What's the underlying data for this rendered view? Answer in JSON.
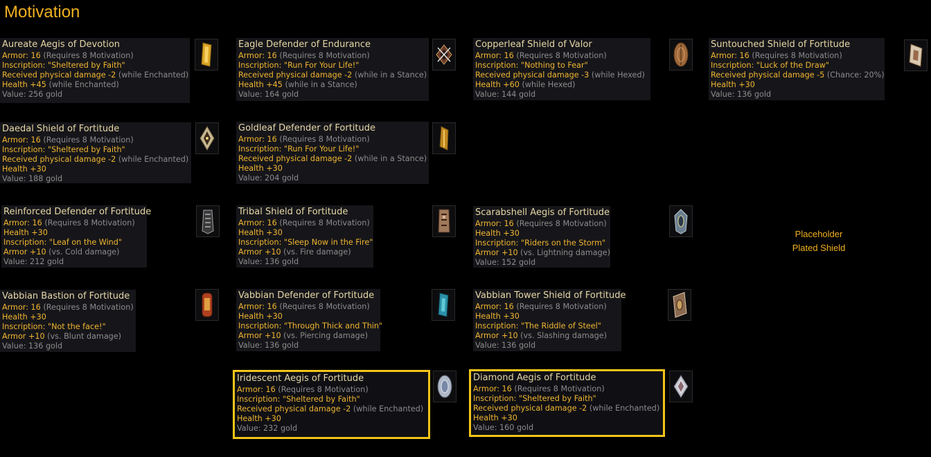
{
  "page_title": "Motivation",
  "placeholder": {
    "line1": "Placeholder",
    "line2": "Plated Shield"
  },
  "items": {
    "aureate": {
      "name": "Aureate Aegis of Devotion",
      "armor_label": "Armor: 16",
      "armor_req": "(Requires 8 Motivation)",
      "inscription": "Inscription: \"Sheltered by Faith\"",
      "dmg_label": "Received physical damage -2",
      "dmg_cond": "(while Enchanted)",
      "health_label": "Health +45",
      "health_cond": "(while Enchanted)",
      "value": "Value: 256 gold",
      "icon": "gold-aegis-shield-icon"
    },
    "eagle": {
      "name": "Eagle Defender of Endurance",
      "armor_label": "Armor: 16",
      "armor_req": "(Requires 8 Motivation)",
      "inscription": "Inscription: \"Run For Your Life!\"",
      "dmg_label": "Received physical damage -2",
      "dmg_cond": "(while in a Stance)",
      "health_label": "Health +45",
      "health_cond": "(while in a Stance)",
      "value": "Value: 164 gold",
      "icon": "eagle-shield-icon"
    },
    "copperleaf": {
      "name": "Copperleaf Shield of Valor",
      "armor_label": "Armor: 16",
      "armor_req": "(Requires 8 Motivation)",
      "inscription": "Inscription: \"Nothing to Fear\"",
      "dmg_label": "Received physical damage -3",
      "dmg_cond": "(while Hexed)",
      "health_label": "Health +60",
      "health_cond": "(while Hexed)",
      "value": "Value: 144 gold",
      "icon": "copper-leaf-shield-icon"
    },
    "suntouched": {
      "name": "Suntouched Shield of Fortitude",
      "armor_label": "Armor: 16",
      "armor_req": "(Requires 8 Motivation)",
      "inscription": "Inscription: \"Luck of the Draw\"",
      "dmg_label": "Received physical damage -5",
      "dmg_cond": "(Chance: 20%)",
      "health_label": "Health +30",
      "value": "Value: 136 gold",
      "icon": "sun-shield-icon"
    },
    "daedal": {
      "name": "Daedal Shield of Fortitude",
      "armor_label": "Armor: 16",
      "armor_req": "(Requires 8 Motivation)",
      "inscription": "Inscription: \"Sheltered by Faith\"",
      "dmg_label": "Received physical damage -2",
      "dmg_cond": "(while Enchanted)",
      "health_label": "Health +30",
      "value": "Value: 188 gold",
      "icon": "daedal-shield-icon"
    },
    "goldleaf": {
      "name": "Goldleaf Defender of Fortitude",
      "armor_label": "Armor: 16",
      "armor_req": "(Requires 8 Motivation)",
      "inscription": "Inscription: \"Run For Your Life!\"",
      "dmg_label": "Received physical damage -2",
      "dmg_cond": "(while in a Stance)",
      "health_label": "Health +30",
      "value": "Value: 204 gold",
      "icon": "gold-leaf-shield-icon"
    },
    "reinforced": {
      "name": "Reinforced Defender of Fortitude",
      "armor_label": "Armor: 16",
      "armor_req": "(Requires 8 Motivation)",
      "health_label": "Health +30",
      "inscription": "Inscription: \"Leaf on the Wind\"",
      "armor_bonus_label": "Armor +10",
      "armor_bonus_cond": "(vs. Cold damage)",
      "value": "Value: 212 gold",
      "icon": "reinforced-shield-icon"
    },
    "tribal": {
      "name": "Tribal Shield of Fortitude",
      "armor_label": "Armor: 16",
      "armor_req": "(Requires 8 Motivation)",
      "health_label": "Health +30",
      "inscription": "Inscription: \"Sleep Now in the Fire\"",
      "armor_bonus_label": "Armor +10",
      "armor_bonus_cond": "(vs. Fire damage)",
      "value": "Value: 136 gold",
      "icon": "tribal-shield-icon"
    },
    "scarab": {
      "name": "Scarabshell Aegis of Fortitude",
      "armor_label": "Armor: 16",
      "armor_req": "(Requires 8 Motivation)",
      "health_label": "Health +30",
      "inscription": "Inscription: \"Riders on the Storm\"",
      "armor_bonus_label": "Armor +10",
      "armor_bonus_cond": "(vs. Lightning damage)",
      "value": "Value: 152 gold",
      "icon": "scarab-shield-icon"
    },
    "bastion": {
      "name": "Vabbian Bastion of Fortitude",
      "armor_label": "Armor: 16",
      "armor_req": "(Requires 8 Motivation)",
      "health_label": "Health +30",
      "inscription": "Inscription: \"Not the face!\"",
      "armor_bonus_label": "Armor +10",
      "armor_bonus_cond": "(vs. Blunt damage)",
      "value": "Value: 136 gold",
      "icon": "vabbian-bastion-icon"
    },
    "vdefender": {
      "name": "Vabbian Defender of Fortitude",
      "armor_label": "Armor: 16",
      "armor_req": "(Requires 8 Motivation)",
      "health_label": "Health +30",
      "inscription": "Inscription: \"Through Thick and Thin\"",
      "armor_bonus_label": "Armor +10",
      "armor_bonus_cond": "(vs. Piercing damage)",
      "value": "Value: 136 gold",
      "icon": "vabbian-defender-icon"
    },
    "tower": {
      "name": "Vabbian Tower Shield of Fortitude",
      "armor_label": "Armor: 16",
      "armor_req": "(Requires 8 Motivation)",
      "health_label": "Health +30",
      "inscription": "Inscription: \"The Riddle of Steel\"",
      "armor_bonus_label": "Armor +10",
      "armor_bonus_cond": "(vs. Slashing damage)",
      "value": "Value: 136 gold",
      "icon": "vabbian-tower-shield-icon"
    },
    "iridescent": {
      "name": "Iridescent Aegis of Fortitude",
      "armor_label": "Armor: 16",
      "armor_req": "(Requires 8 Motivation)",
      "inscription": "Inscription: \"Sheltered by Faith\"",
      "dmg_label": "Received physical damage -2",
      "dmg_cond": "(while Enchanted)",
      "health_label": "Health +30",
      "value": "Value: 232 gold",
      "icon": "iridescent-aegis-icon"
    },
    "diamond": {
      "name": "Diamond Aegis of Fortitude",
      "armor_label": "Armor: 16",
      "armor_req": "(Requires 8 Motivation)",
      "inscription": "Inscription: \"Sheltered by Faith\"",
      "dmg_label": "Received physical damage -2",
      "dmg_cond": "(while Enchanted)",
      "health_label": "Health +30",
      "value": "Value: 160 gold",
      "icon": "diamond-aegis-icon"
    }
  },
  "colors": {
    "title": "#f0b020",
    "label": "#f0b530",
    "dim": "#8c8c8c",
    "name": "#e6d7a6",
    "highlight": "#f2c418"
  }
}
